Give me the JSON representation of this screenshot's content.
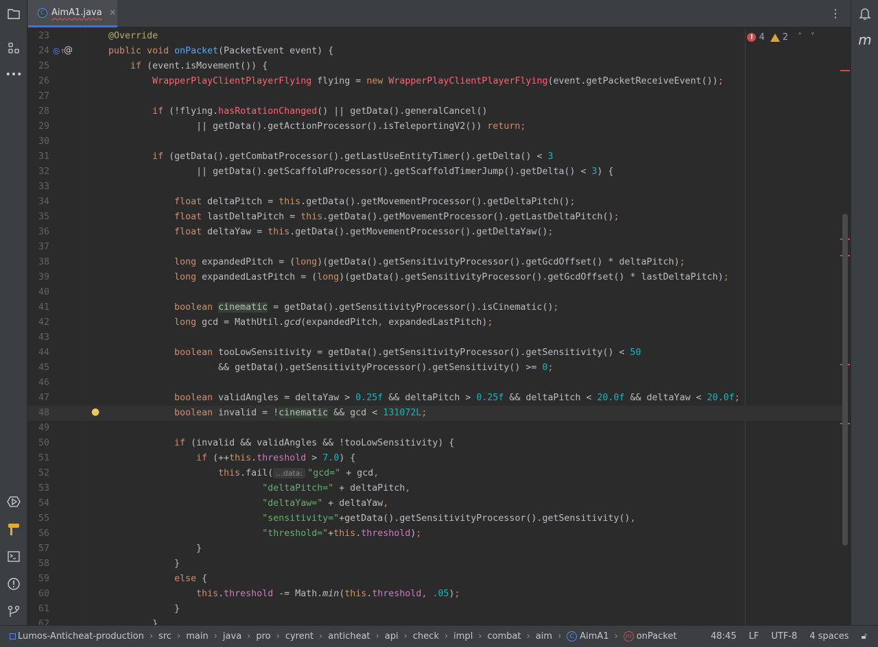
{
  "tab": {
    "label": "AimA1.java",
    "close": "×"
  },
  "inspections": {
    "errors": "4",
    "warnings": "2"
  },
  "right_sidebar": {
    "plugin_letter": "m"
  },
  "status": {
    "breadcrumbs": [
      "Lumos-Anticheat-production",
      "src",
      "main",
      "java",
      "pro",
      "cyrent",
      "anticheat",
      "api",
      "check",
      "impl",
      "combat",
      "aim",
      "AimA1",
      "onPacket"
    ],
    "position": "48:45",
    "line_ending": "LF",
    "encoding": "UTF-8",
    "indent": "4 spaces"
  },
  "colors": {
    "accent": "#3574f0",
    "error": "#c94f4f",
    "warning": "#d9a343",
    "keyword": "#cf8e6d",
    "string": "#6aab73",
    "number": "#2aacb8"
  },
  "code": {
    "current_line": 48,
    "lines": [
      {
        "n": "23",
        "tokens": [
          [
            "t",
            "    "
          ],
          [
            "a",
            "@Override"
          ]
        ]
      },
      {
        "n": "24",
        "tokens": [
          [
            "t",
            "    "
          ],
          [
            "k",
            "public void "
          ],
          [
            "m",
            "onPacket"
          ],
          [
            "t",
            "(PacketEvent event) {"
          ]
        ]
      },
      {
        "n": "25",
        "tokens": [
          [
            "t",
            "        "
          ],
          [
            "k",
            "if "
          ],
          [
            "t",
            "(event.isMovement()) {"
          ]
        ]
      },
      {
        "n": "26",
        "tokens": [
          [
            "t",
            "            "
          ],
          [
            "e",
            "WrapperPlayClientPlayerFlying"
          ],
          [
            "t",
            " flying = "
          ],
          [
            "k",
            "new "
          ],
          [
            "e",
            "WrapperPlayClientPlayerFlying"
          ],
          [
            "t",
            "(event.getPacketReceiveEvent())"
          ],
          [
            "k",
            ";"
          ]
        ]
      },
      {
        "n": "27",
        "tokens": []
      },
      {
        "n": "28",
        "tokens": [
          [
            "t",
            "            "
          ],
          [
            "k",
            "if "
          ],
          [
            "t",
            "(!flying."
          ],
          [
            "e",
            "hasRotationChanged"
          ],
          [
            "t",
            "() || getData().generalCancel()"
          ]
        ]
      },
      {
        "n": "29",
        "tokens": [
          [
            "t",
            "                    || getData().getActionProcessor().isTeleportingV2()) "
          ],
          [
            "k",
            "return;"
          ]
        ]
      },
      {
        "n": "30",
        "tokens": []
      },
      {
        "n": "31",
        "tokens": [
          [
            "t",
            "            "
          ],
          [
            "k",
            "if "
          ],
          [
            "t",
            "(getData().getCombatProcessor().getLastUseEntityTimer().getDelta() < "
          ],
          [
            "n",
            "3"
          ]
        ]
      },
      {
        "n": "32",
        "tokens": [
          [
            "t",
            "                    || getData().getScaffoldProcessor().getScaffoldTimerJump().getDelta() < "
          ],
          [
            "n",
            "3"
          ],
          [
            "t",
            ") {"
          ]
        ]
      },
      {
        "n": "33",
        "tokens": []
      },
      {
        "n": "34",
        "tokens": [
          [
            "t",
            "                "
          ],
          [
            "k",
            "float "
          ],
          [
            "t",
            "deltaPitch = "
          ],
          [
            "k",
            "this"
          ],
          [
            "t",
            ".getData().getMovementProcessor().getDeltaPitch()"
          ],
          [
            "k",
            ";"
          ]
        ]
      },
      {
        "n": "35",
        "tokens": [
          [
            "t",
            "                "
          ],
          [
            "k",
            "float "
          ],
          [
            "t",
            "lastDeltaPitch = "
          ],
          [
            "k",
            "this"
          ],
          [
            "t",
            ".getData().getMovementProcessor().getLastDeltaPitch()"
          ],
          [
            "k",
            ";"
          ]
        ]
      },
      {
        "n": "36",
        "tokens": [
          [
            "t",
            "                "
          ],
          [
            "k",
            "float "
          ],
          [
            "t",
            "deltaYaw = "
          ],
          [
            "k",
            "this"
          ],
          [
            "t",
            ".getData().getMovementProcessor().getDeltaYaw()"
          ],
          [
            "k",
            ";"
          ]
        ]
      },
      {
        "n": "37",
        "tokens": []
      },
      {
        "n": "38",
        "tokens": [
          [
            "t",
            "                "
          ],
          [
            "k",
            "long "
          ],
          [
            "t",
            "expandedPitch = ("
          ],
          [
            "k",
            "long"
          ],
          [
            "t",
            ")(getData().getSensitivityProcessor().getGcdOffset() * deltaPitch)"
          ],
          [
            "k",
            ";"
          ]
        ]
      },
      {
        "n": "39",
        "tokens": [
          [
            "t",
            "                "
          ],
          [
            "k",
            "long "
          ],
          [
            "t",
            "expandedLastPitch = ("
          ],
          [
            "k",
            "long"
          ],
          [
            "t",
            ")(getData().getSensitivityProcessor().getGcdOffset() * lastDeltaPitch)"
          ],
          [
            "k",
            ";"
          ]
        ]
      },
      {
        "n": "40",
        "tokens": []
      },
      {
        "n": "41",
        "tokens": [
          [
            "t",
            "                "
          ],
          [
            "k",
            "boolean "
          ],
          [
            "c",
            "cinematic"
          ],
          [
            "t",
            " = getData().getSensitivityProcessor().isCinematic()"
          ],
          [
            "k",
            ";"
          ]
        ]
      },
      {
        "n": "42",
        "tokens": [
          [
            "t",
            "                "
          ],
          [
            "k",
            "long "
          ],
          [
            "t",
            "gcd = MathUtil."
          ],
          [
            "i",
            "gcd"
          ],
          [
            "t",
            "(expandedPitch"
          ],
          [
            "k",
            ", "
          ],
          [
            "t",
            "expandedLastPitch)"
          ],
          [
            "k",
            ";"
          ]
        ]
      },
      {
        "n": "43",
        "tokens": []
      },
      {
        "n": "44",
        "tokens": [
          [
            "t",
            "                "
          ],
          [
            "k",
            "boolean "
          ],
          [
            "t",
            "tooLowSensitivity = getData().getSensitivityProcessor().getSensitivity() < "
          ],
          [
            "n",
            "50"
          ]
        ]
      },
      {
        "n": "45",
        "tokens": [
          [
            "t",
            "                        && getData().getSensitivityProcessor().getSensitivity() >= "
          ],
          [
            "n",
            "0"
          ],
          [
            "k",
            ";"
          ]
        ]
      },
      {
        "n": "46",
        "tokens": []
      },
      {
        "n": "47",
        "tokens": [
          [
            "t",
            "                "
          ],
          [
            "k",
            "boolean "
          ],
          [
            "t",
            "validAngles = deltaYaw > "
          ],
          [
            "n",
            "0.25f"
          ],
          [
            "t",
            " && deltaPitch > "
          ],
          [
            "n",
            "0.25f"
          ],
          [
            "t",
            " && deltaPitch < "
          ],
          [
            "n",
            "20.0f"
          ],
          [
            "t",
            " && deltaYaw < "
          ],
          [
            "n",
            "20.0f"
          ],
          [
            "k",
            ";"
          ]
        ]
      },
      {
        "n": "48",
        "tokens": [
          [
            "t",
            "                "
          ],
          [
            "k",
            "boolean "
          ],
          [
            "t",
            "invalid = !"
          ],
          [
            "c",
            "cinematic"
          ],
          [
            "t",
            " && gcd < "
          ],
          [
            "n",
            "131072L"
          ],
          [
            "k",
            ";"
          ]
        ]
      },
      {
        "n": "49",
        "tokens": []
      },
      {
        "n": "50",
        "tokens": [
          [
            "t",
            "                "
          ],
          [
            "k",
            "if "
          ],
          [
            "t",
            "(invalid && validAngles && !tooLowSensitivity) {"
          ]
        ]
      },
      {
        "n": "51",
        "tokens": [
          [
            "t",
            "                    "
          ],
          [
            "k",
            "if "
          ],
          [
            "t",
            "(++"
          ],
          [
            "k",
            "this"
          ],
          [
            "t",
            "."
          ],
          [
            "f",
            "threshold"
          ],
          [
            "t",
            " > "
          ],
          [
            "n",
            "7.0"
          ],
          [
            "t",
            ") {"
          ]
        ]
      },
      {
        "n": "52",
        "tokens": [
          [
            "t",
            "                        "
          ],
          [
            "k",
            "this"
          ],
          [
            "t",
            ".fail("
          ],
          [
            "h",
            "...data:"
          ],
          [
            "s",
            "\"gcd=\""
          ],
          [
            "t",
            " + gcd"
          ],
          [
            "k",
            ","
          ]
        ]
      },
      {
        "n": "53",
        "tokens": [
          [
            "t",
            "                                "
          ],
          [
            "s",
            "\"deltaPitch=\""
          ],
          [
            "t",
            " + deltaPitch"
          ],
          [
            "k",
            ","
          ]
        ]
      },
      {
        "n": "54",
        "tokens": [
          [
            "t",
            "                                "
          ],
          [
            "s",
            "\"deltaYaw=\""
          ],
          [
            "t",
            " + deltaYaw"
          ],
          [
            "k",
            ","
          ]
        ]
      },
      {
        "n": "55",
        "tokens": [
          [
            "t",
            "                                "
          ],
          [
            "s",
            "\"sensitivity=\""
          ],
          [
            "t",
            "+getData().getSensitivityProcessor().getSensitivity()"
          ],
          [
            "k",
            ","
          ]
        ]
      },
      {
        "n": "56",
        "tokens": [
          [
            "t",
            "                                "
          ],
          [
            "s",
            "\"threshold=\""
          ],
          [
            "t",
            "+"
          ],
          [
            "k",
            "this"
          ],
          [
            "t",
            "."
          ],
          [
            "f",
            "threshold"
          ],
          [
            "t",
            ")"
          ],
          [
            "k",
            ";"
          ]
        ]
      },
      {
        "n": "57",
        "tokens": [
          [
            "t",
            "                    }"
          ]
        ]
      },
      {
        "n": "58",
        "tokens": [
          [
            "t",
            "                }"
          ]
        ]
      },
      {
        "n": "59",
        "tokens": [
          [
            "t",
            "                "
          ],
          [
            "k",
            "else "
          ],
          [
            "t",
            "{"
          ]
        ]
      },
      {
        "n": "60",
        "tokens": [
          [
            "t",
            "                    "
          ],
          [
            "k",
            "this"
          ],
          [
            "t",
            "."
          ],
          [
            "f",
            "threshold"
          ],
          [
            "t",
            " -= Math."
          ],
          [
            "i",
            "min"
          ],
          [
            "t",
            "("
          ],
          [
            "k",
            "this"
          ],
          [
            "t",
            "."
          ],
          [
            "f",
            "threshold"
          ],
          [
            "k",
            ", "
          ],
          [
            "n",
            ".05"
          ],
          [
            "t",
            ")"
          ],
          [
            "k",
            ";"
          ]
        ]
      },
      {
        "n": "61",
        "tokens": [
          [
            "t",
            "                }"
          ]
        ]
      },
      {
        "n": "62",
        "tokens": [
          [
            "t",
            "            }"
          ]
        ]
      }
    ]
  }
}
